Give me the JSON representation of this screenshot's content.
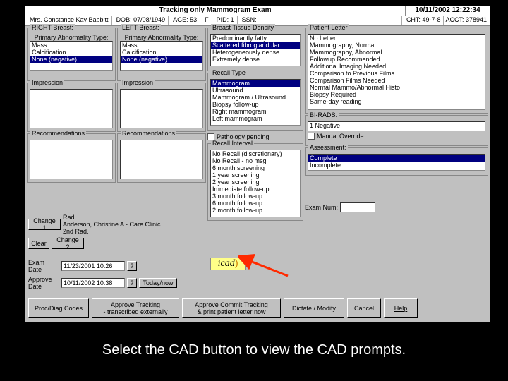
{
  "title": "Tracking only Mammogram Exam",
  "timestamp": "10/11/2002 12:22:34",
  "patient": {
    "name": "Mrs. Constance Kay Babbitt",
    "dob": "DOB: 07/08/1949",
    "age": "AGE: 53",
    "sex": "F",
    "pid": "PID: 1",
    "ssn": "SSN:",
    "cht": "CHT: 49-7-8",
    "acct": "ACCT: 378941"
  },
  "right_breast": {
    "label": "RIGHT Breast:",
    "primary_label": "Primary Abnormality Type:",
    "primary_items": [
      "Mass",
      "Calcification",
      "None (negative)"
    ],
    "primary_selected": 2,
    "impression_label": "Impression",
    "recommendations_label": "Recommendations"
  },
  "left_breast": {
    "label": "LEFT Breast:",
    "primary_label": "Primary Abnormality Type:",
    "primary_items": [
      "Mass",
      "Calcification",
      "None (negative)"
    ],
    "primary_selected": 2,
    "impression_label": "Impression",
    "recommendations_label": "Recommendations"
  },
  "density": {
    "label": "Breast Tissue Density",
    "items": [
      "Predominantly fatty",
      "Scattered fibroglandular",
      "Heterogeneously dense",
      "Extremely dense"
    ],
    "selected": 1
  },
  "recall_type": {
    "label": "Recall Type",
    "items": [
      "Mammogram",
      "Ultrasound",
      "Mammogram / Ultrasound",
      "Biopsy follow-up",
      "Right mammogram",
      "Left mammogram"
    ],
    "selected": 0
  },
  "pathology_pending": "Pathology pending",
  "recall_interval": {
    "label": "Recall Interval",
    "items": [
      "No Recall (discretionary)",
      "No Recall - no msg",
      "6 month screening",
      "1 year screening",
      "2 year screening",
      "Immediate follow-up",
      "3 month follow-up",
      "6 month follow-up",
      "2 month follow-up"
    ]
  },
  "patient_letter": {
    "label": "Patient Letter",
    "items": [
      "No Letter",
      "Mammography, Normal",
      "Mammography, Abnormal",
      "Followup Recommended",
      "Additional Imaging Needed",
      "Comparison to Previous Films",
      "Comparison Films Needed",
      "Normal Mammo/Abnormal Histo",
      "Biopsy Required",
      "Same-day reading"
    ]
  },
  "birads": {
    "label": "BI-RADS:",
    "value": "1 Negative",
    "override": "Manual Override"
  },
  "assessment": {
    "label": "Assessment:",
    "items": [
      "Complete",
      "Incomplete"
    ],
    "selected": 0
  },
  "exam_num_label": "Exam Num:",
  "rad": {
    "label": "Rad.",
    "name": "Anderson, Christine A - Care Clinic",
    "second_label": "2nd Rad."
  },
  "change1_btn": "Change 1",
  "change2_btn": "Change 2",
  "clear_btn": "Clear",
  "exam_date_label": "Exam Date",
  "exam_date": "11/23/2001 10:26",
  "approve_date_label": "Approve Date",
  "approve_date": "10/11/2002 10:38",
  "today_btn": "Today/now",
  "icad_label": "icad",
  "buttons": {
    "proc": "Proc/Diag Codes",
    "approve_tracking": "Approve Tracking\n- transcribed externally",
    "approve_commit": "Approve Commit Tracking\n& print patient letter now",
    "dictate": "Dictate / Modify",
    "cancel": "Cancel",
    "help": "Help"
  },
  "caption": "Select the CAD button to view the CAD prompts."
}
